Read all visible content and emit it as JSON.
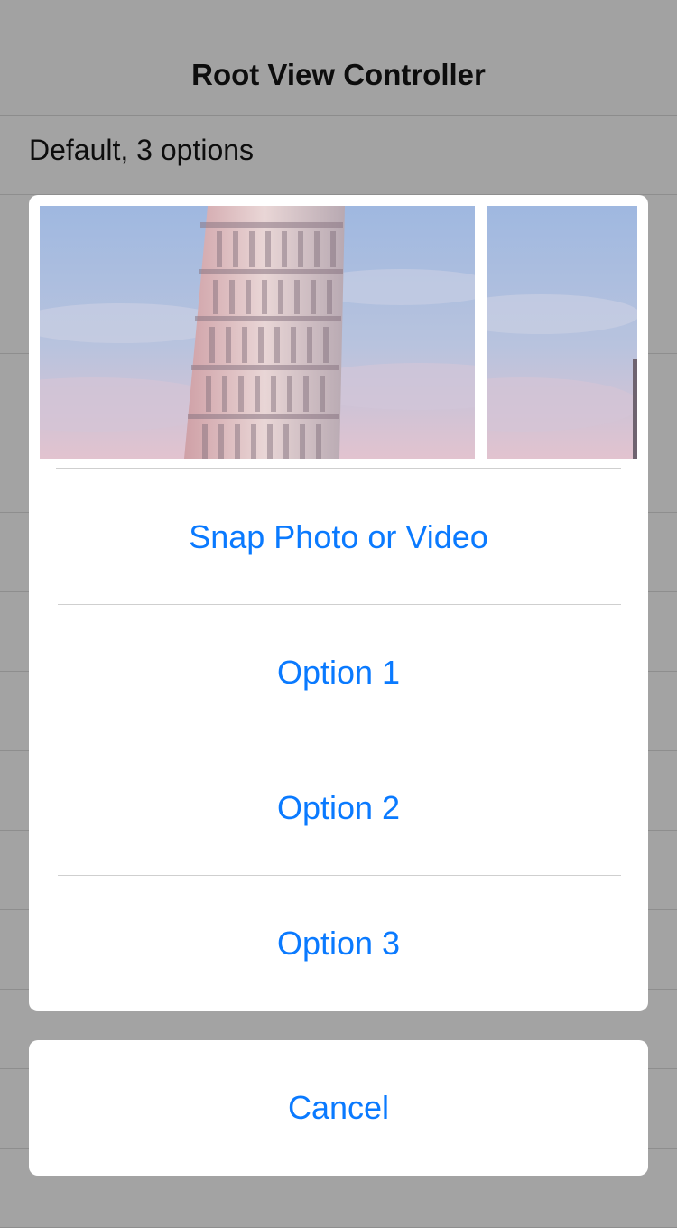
{
  "navbar": {
    "title": "Root View Controller"
  },
  "table": {
    "first_row_label": "Default, 3 options"
  },
  "action_sheet": {
    "photos": [
      "leaning-tower-photo",
      "leaning-tower-photo"
    ],
    "options": [
      "Snap Photo or Video",
      "Option 1",
      "Option 2",
      "Option 3"
    ],
    "cancel_label": "Cancel"
  },
  "colors": {
    "accent": "#0a7aff",
    "dim_background": "#a3a3a3",
    "sheet_background": "#ffffff"
  }
}
